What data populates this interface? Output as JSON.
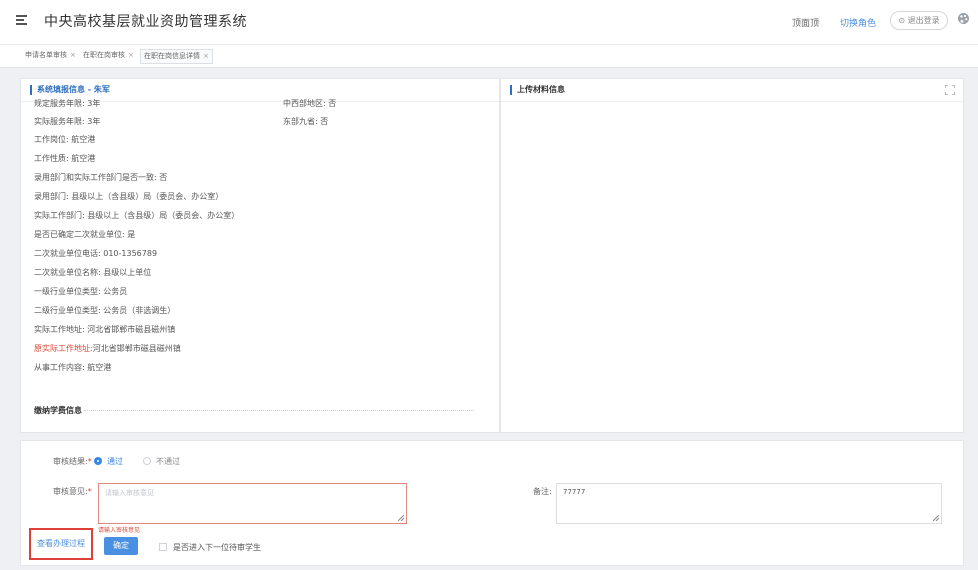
{
  "header": {
    "app_title": "中央高校基层就业资助管理系统",
    "home_label": "顶面顶",
    "switch_role_label": "切换角色",
    "logout_label": "退出登录"
  },
  "tabs": [
    {
      "label": "申请名单审核",
      "close": "×"
    },
    {
      "label": "在职在岗审核",
      "close": "×"
    },
    {
      "label": "在职在岗信息详情",
      "close": "×"
    }
  ],
  "left_panel": {
    "title": "系统填报信息 - 朱军",
    "rows": [
      {
        "label": "规定服务年限:",
        "value": "3年"
      },
      {
        "label": "实际服务年限:",
        "value": "3年"
      },
      {
        "label": "工作岗位:",
        "value": "航空港"
      },
      {
        "label": "工作性质:",
        "value": "航空港"
      },
      {
        "label": "录用部门和实际工作部门是否一致:",
        "value": "否"
      },
      {
        "label": "录用部门:",
        "value": "县级以上（含县级）局（委员会、办公室）"
      },
      {
        "label": "实际工作部门:",
        "value": "县级以上（含县级）局（委员会、办公室）"
      },
      {
        "label": "是否已确定二次就业单位:",
        "value": "是"
      },
      {
        "label": "二次就业单位电话:",
        "value": "010-1356789"
      },
      {
        "label": "二次就业单位名称:",
        "value": "县级以上单位"
      },
      {
        "label": "一级行业单位类型:",
        "value": "公务员"
      },
      {
        "label": "二级行业单位类型:",
        "value": "公务员（非选调生）"
      },
      {
        "label": "实际工作地址:",
        "value": "河北省邯郸市磁县磁州镇"
      },
      {
        "label": "原实际工作地址:",
        "value": "河北省邯郸市磁县磁州镇"
      },
      {
        "label": "从事工作内容:",
        "value": "航空港"
      }
    ],
    "right_rows": [
      {
        "label": "中西部地区:",
        "value": "否"
      },
      {
        "label": "东部九省:",
        "value": "否"
      }
    ],
    "section_title": "缴纳学费信息"
  },
  "right_panel": {
    "title": "上传材料信息"
  },
  "review": {
    "result_label": "审核结果:",
    "required_mark": "*",
    "pass_label": "通过",
    "fail_label": "不通过",
    "opinion_label": "审核意见:",
    "opinion_placeholder": "请输入审核意见",
    "opinion_error": "请输入审核意见",
    "remark_label": "备注:",
    "remark_value": "77777",
    "process_link": "查看办理过程",
    "confirm_label": "确定",
    "next_label": "是否进入下一位待审学生"
  },
  "colors": {
    "accent": "#4a90e2",
    "error": "#d94b3a",
    "highlight_box": "#e0403a"
  }
}
